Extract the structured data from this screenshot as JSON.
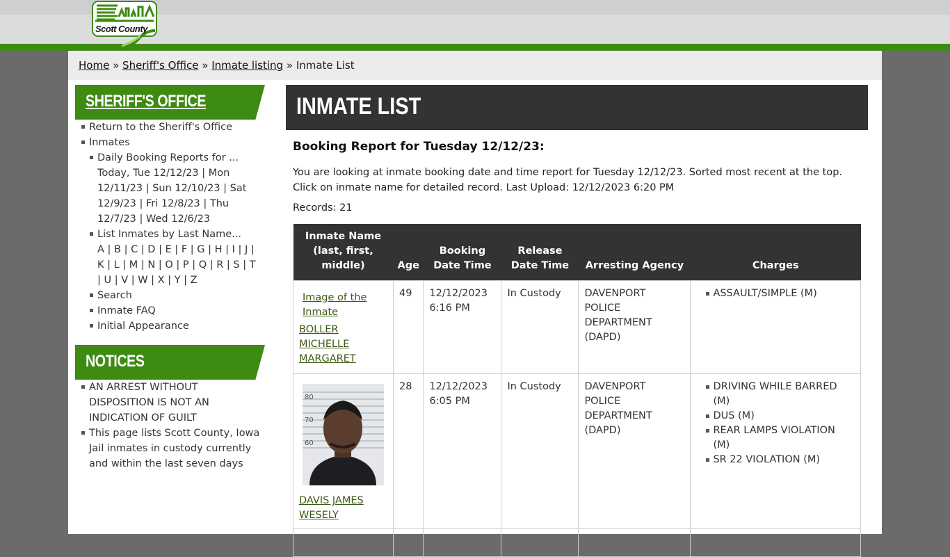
{
  "site": {
    "logo_text": "Scott County"
  },
  "breadcrumb": {
    "home": "Home",
    "sep1": "»",
    "sheriff": "Sheriff's Office",
    "sep2": "»",
    "listing": "Inmate listing",
    "sep3": "»",
    "current": "Inmate List"
  },
  "sidebar": {
    "section1_title": "SHERIFF'S OFFICE",
    "return": "Return to the Sheriff's Office",
    "inmates": "Inmates",
    "daily": "Daily Booking Reports for ...",
    "days": "Today, Tue 12/12/23 | Mon 12/11/23 | Sun 12/10/23 | Sat 12/9/23 | Fri 12/8/23 | Thu 12/7/23 | Wed 12/6/23",
    "list_by_name": "List Inmates by Last Name...",
    "letters": "A | B | C | D | E | F | G | H | I | J | K | L | M | N | O | P | Q | R | S | T | U | V | W | X | Y | Z",
    "search": "Search",
    "faq": "Inmate FAQ",
    "initial": "Initial Appearance",
    "section2_title": "NOTICES",
    "notice1": "AN ARREST WITHOUT DISPOSITION IS NOT AN INDICATION OF GUILT",
    "notice2": "This page lists Scott County, Iowa Jail inmates in custody currently and within the last seven days"
  },
  "main": {
    "title": "INMATE LIST",
    "report_title": "Booking Report for Tuesday 12/12/23:",
    "desc1": "You are looking at inmate booking date and time report for Tuesday 12/12/23. Sorted most recent at the top.",
    "desc2": "Click on inmate name for detailed record. Last Upload: 12/12/2023 6:20 PM",
    "records": "Records: 21"
  },
  "table": {
    "headers": {
      "name": "Inmate Name (last, first, middle)",
      "age": "Age",
      "booking": "Booking Date Time",
      "release": "Release Date Time",
      "agency": "Arresting Agency",
      "charges": "Charges"
    },
    "rows": [
      {
        "image_alt": "Image of the Inmate",
        "name": "BOLLER MICHELLE MARGARET",
        "age": "49",
        "booking": "12/12/2023 6:16 PM",
        "release": "In Custody",
        "agency": "DAVENPORT POLICE DEPARTMENT (DAPD)",
        "charges": [
          "ASSAULT/SIMPLE (M)"
        ]
      },
      {
        "image_alt": "",
        "name": "DAVIS JAMES WESELY",
        "age": "28",
        "booking": "12/12/2023 6:05 PM",
        "release": "In Custody",
        "agency": "DAVENPORT POLICE DEPARTMENT (DAPD)",
        "charges": [
          "DRIVING WHILE BARRED (M)",
          "DUS (M)",
          "REAR LAMPS VIOLATION (M)",
          "SR 22 VIOLATION (M)"
        ]
      }
    ]
  },
  "colors": {
    "brand_green": "#3d8b13",
    "header_dark": "#333333",
    "link": "#3a5a12"
  }
}
